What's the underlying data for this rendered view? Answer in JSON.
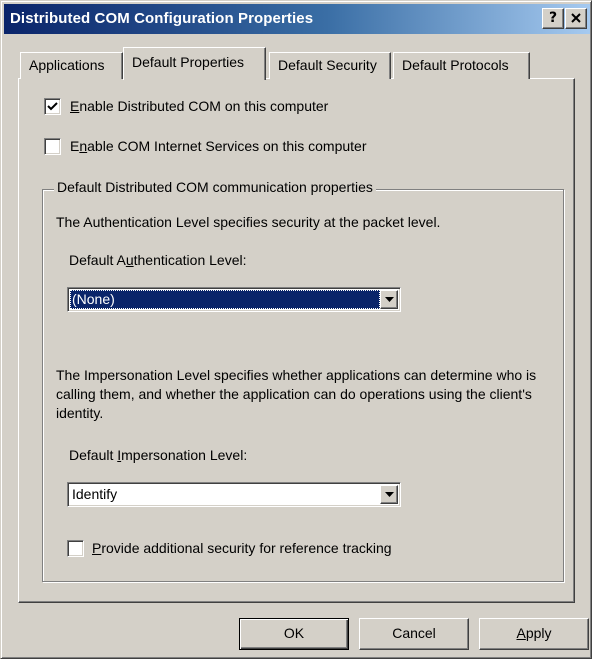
{
  "window": {
    "title": "Distributed COM Configuration Properties",
    "help_button": "?",
    "close_button": "✕"
  },
  "tabs": [
    {
      "label": "Applications",
      "active": false
    },
    {
      "label": "Default Properties",
      "active": true
    },
    {
      "label": "Default Security",
      "active": false
    },
    {
      "label": "Default Protocols",
      "active": false
    }
  ],
  "options": {
    "enable_dcom": {
      "pre": "",
      "key": "E",
      "post": "nable Distributed COM on this computer",
      "checked": true
    },
    "enable_cis": {
      "pre": "E",
      "key": "n",
      "post": "able COM Internet Services on this computer",
      "checked": false
    }
  },
  "group": {
    "title": "Default Distributed COM communication properties",
    "auth_description": "The Authentication Level specifies security at the packet level.",
    "auth_label": {
      "pre": "Default A",
      "key": "u",
      "post": "thentication Level:"
    },
    "auth_value": "(None)",
    "imp_description": "The Impersonation Level specifies whether applications can determine who is calling them, and whether the application can do operations using the client's identity.",
    "imp_label": {
      "pre": "Default ",
      "key": "I",
      "post": "mpersonation Level:"
    },
    "imp_value": "Identify",
    "ref_tracking": {
      "pre": "",
      "key": "P",
      "post": "rovide additional security for reference tracking",
      "checked": false
    }
  },
  "buttons": {
    "ok": "OK",
    "cancel": "Cancel",
    "apply": {
      "pre": "",
      "key": "A",
      "post": "pply"
    }
  }
}
